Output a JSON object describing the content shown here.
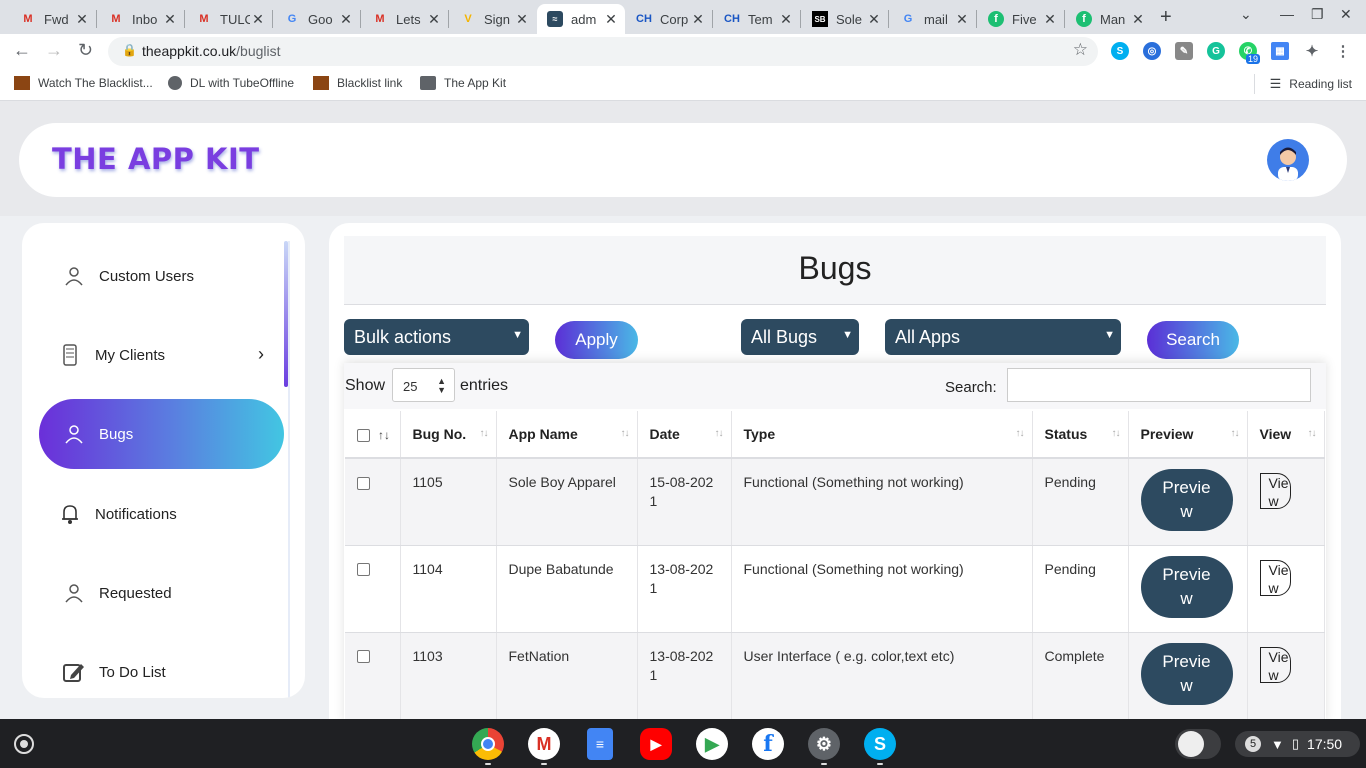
{
  "browser": {
    "tabs": [
      {
        "label": "Fwd",
        "icon": "gmail-icon"
      },
      {
        "label": "Inbo",
        "icon": "gmail-icon"
      },
      {
        "label": "TULC",
        "icon": "gmail-icon"
      },
      {
        "label": "Goo",
        "icon": "google-icon"
      },
      {
        "label": "Lets",
        "icon": "gmail-icon"
      },
      {
        "label": "Sign",
        "icon": "v-icon"
      },
      {
        "label": "adm",
        "icon": "site-icon"
      },
      {
        "label": "Corp",
        "icon": "ch-icon"
      },
      {
        "label": "Tem",
        "icon": "ch-icon"
      },
      {
        "label": "Sole",
        "icon": "sole-icon"
      },
      {
        "label": "mail",
        "icon": "google-icon"
      },
      {
        "label": "Five",
        "icon": "fiverr-icon"
      },
      {
        "label": "Man",
        "icon": "fiverr-icon"
      }
    ],
    "url_host": "theappkit.co.uk",
    "url_path": "/buglist",
    "extension_badge": "19",
    "bookmarks": [
      {
        "label": "Watch The Blacklist..."
      },
      {
        "label": "DL with TubeOffline"
      },
      {
        "label": "Blacklist link"
      },
      {
        "label": "The App Kit"
      }
    ],
    "reading_list": "Reading list"
  },
  "header": {
    "logo": "THE APP KIT"
  },
  "sidebar": {
    "items": [
      {
        "label": "Custom Users",
        "icon": "user-icon"
      },
      {
        "label": "My Clients",
        "icon": "phone-icon"
      },
      {
        "label": "Bugs",
        "icon": "user-icon"
      },
      {
        "label": "Notifications",
        "icon": "bell-icon"
      },
      {
        "label": "Requested",
        "icon": "user-icon"
      },
      {
        "label": "To Do List",
        "icon": "edit-icon"
      }
    ]
  },
  "main": {
    "title": "Bugs",
    "bulk_actions": "Bulk actions",
    "apply": "Apply",
    "bugs_filter": "All Bugs",
    "apps_filter": "All Apps",
    "search_button": "Search",
    "show": "Show",
    "page_size": "25",
    "entries": "entries",
    "search_label": "Search:",
    "columns": [
      "Bug No.",
      "App Name",
      "Date",
      "Type",
      "Status",
      "Preview",
      "View"
    ],
    "rows": [
      {
        "bug_no": "1105",
        "app": "Sole Boy Apparel",
        "date": "15-08-2021",
        "type": "Functional (Something not working)",
        "status": "Pending",
        "preview": "Preview",
        "view": "View"
      },
      {
        "bug_no": "1104",
        "app": "Dupe Babatunde",
        "date": "13-08-2021",
        "type": "Functional (Something not working)",
        "status": "Pending",
        "preview": "Preview",
        "view": "View"
      },
      {
        "bug_no": "1103",
        "app": "FetNation",
        "date": "13-08-2021",
        "type": "User Interface ( e.g. color,text etc)",
        "status": "Complete",
        "preview": "Preview",
        "view": "View"
      }
    ]
  },
  "taskbar": {
    "apps": [
      "chrome-icon",
      "gmail-icon",
      "docs-icon",
      "youtube-icon",
      "play-store-icon",
      "facebook-icon",
      "settings-icon",
      "skype-icon"
    ],
    "notification_count": "5",
    "time": "17:50"
  }
}
